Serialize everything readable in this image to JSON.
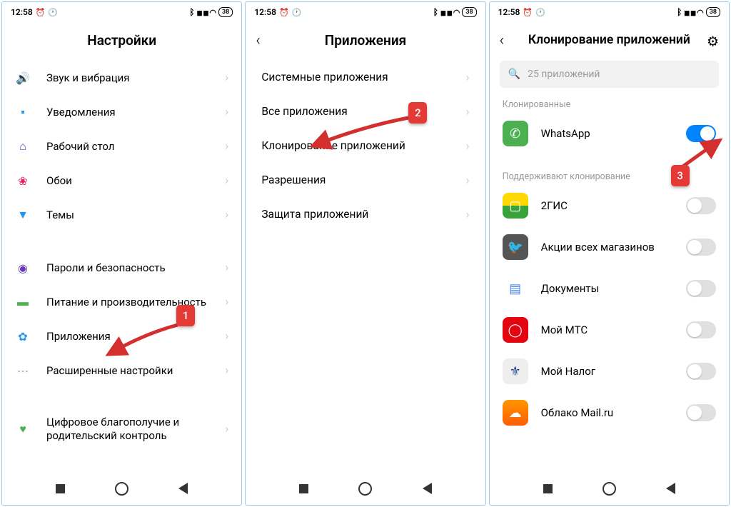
{
  "statusbar": {
    "time": "12:58",
    "battery": "38"
  },
  "screen1": {
    "title": "Настройки",
    "items": [
      {
        "label": "Звук и вибрация"
      },
      {
        "label": "Уведомления"
      },
      {
        "label": "Рабочий стол"
      },
      {
        "label": "Обои"
      },
      {
        "label": "Темы"
      },
      {
        "label": "Пароли и безопасность"
      },
      {
        "label": "Питание и производительность"
      },
      {
        "label": "Приложения"
      },
      {
        "label": "Расширенные настройки"
      },
      {
        "label": "Цифровое благополучие и родительский контроль"
      }
    ]
  },
  "screen2": {
    "title": "Приложения",
    "items": [
      {
        "label": "Системные приложения"
      },
      {
        "label": "Все приложения"
      },
      {
        "label": "Клонирование приложений"
      },
      {
        "label": "Разрешения"
      },
      {
        "label": "Защита приложений"
      }
    ]
  },
  "screen3": {
    "title": "Клонирование приложений",
    "search_placeholder": "25 приложений",
    "section_cloned": "Клонированные",
    "section_support": "Поддерживают клонирование",
    "cloned": [
      {
        "label": "WhatsApp"
      }
    ],
    "support": [
      {
        "label": "2ГИС"
      },
      {
        "label": "Акции всех магазинов"
      },
      {
        "label": "Документы"
      },
      {
        "label": "Мой МТС"
      },
      {
        "label": "Мой Налог"
      },
      {
        "label": "Облако Mail.ru"
      }
    ]
  },
  "anno": {
    "a1": "1",
    "a2": "2",
    "a3": "3"
  }
}
